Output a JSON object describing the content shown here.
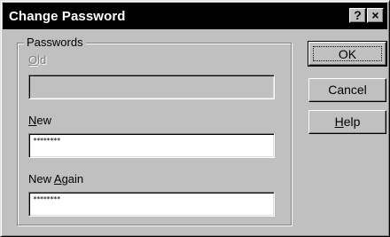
{
  "window": {
    "title": "Change Password",
    "help_glyph": "?",
    "close_glyph": "×"
  },
  "group": {
    "legend": "Passwords",
    "old": {
      "label_first": "O",
      "label_rest": "ld",
      "value": ""
    },
    "new": {
      "label_first": "N",
      "label_rest": "ew",
      "value": "********"
    },
    "again": {
      "label_pre": "New ",
      "label_u": "A",
      "label_rest": "gain",
      "value": "********"
    }
  },
  "buttons": {
    "ok": "OK",
    "cancel": "Cancel",
    "help_u": "H",
    "help_rest": "elp"
  }
}
